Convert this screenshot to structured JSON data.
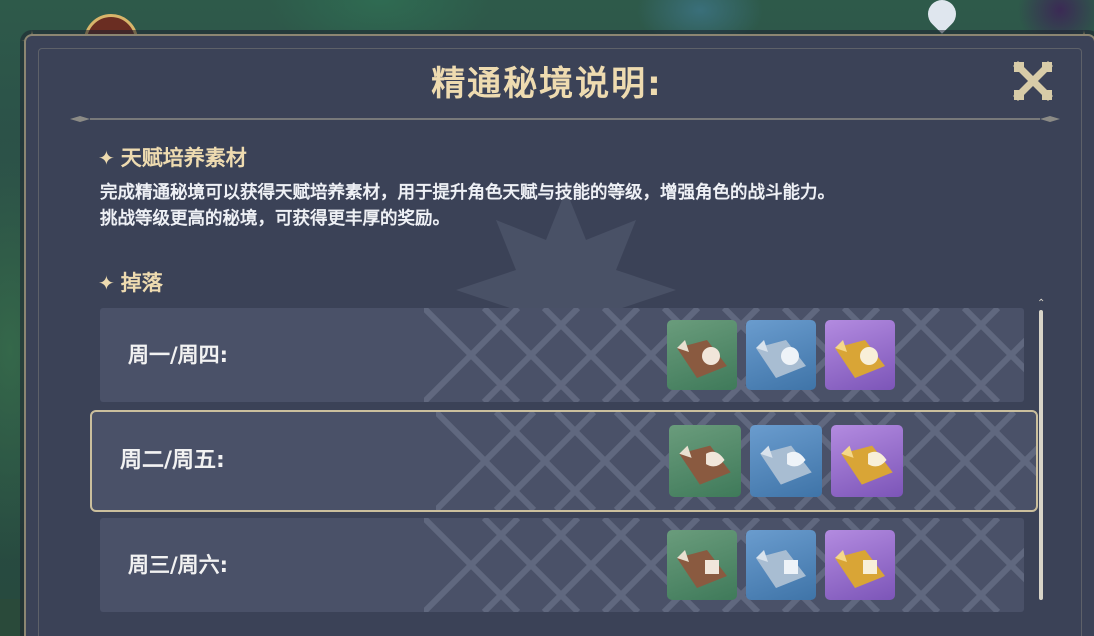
{
  "dialog": {
    "title": "精通秘境说明:",
    "close_icon": "close-x-icon"
  },
  "talent_section": {
    "heading": "天赋培养素材",
    "description_line1": "完成精通秘境可以获得天赋培养素材，用于提升角色天赋与技能的等级，增强角色的战斗能力。",
    "description_line2": "挑战等级更高的秘境，可获得更丰厚的奖励。"
  },
  "drops_section": {
    "heading": "掉落",
    "rows": [
      {
        "label": "周一/周四:",
        "items": [
          "green",
          "blue",
          "purple"
        ],
        "item_icon": "scroll-icon"
      },
      {
        "label": "周二/周五:",
        "items": [
          "green",
          "blue",
          "purple"
        ],
        "item_icon": "scroll-icon",
        "selected": true
      },
      {
        "label": "周三/周六:",
        "items": [
          "green",
          "blue",
          "purple"
        ],
        "item_icon": "scroll-icon"
      }
    ]
  },
  "colors": {
    "accent_gold": "#eedbb0",
    "panel_bg": "#3b4257",
    "row_bg": "#4a5168",
    "rarity_green": "#4f8a68",
    "rarity_blue": "#4f84b8",
    "rarity_purple": "#8c65c8"
  }
}
